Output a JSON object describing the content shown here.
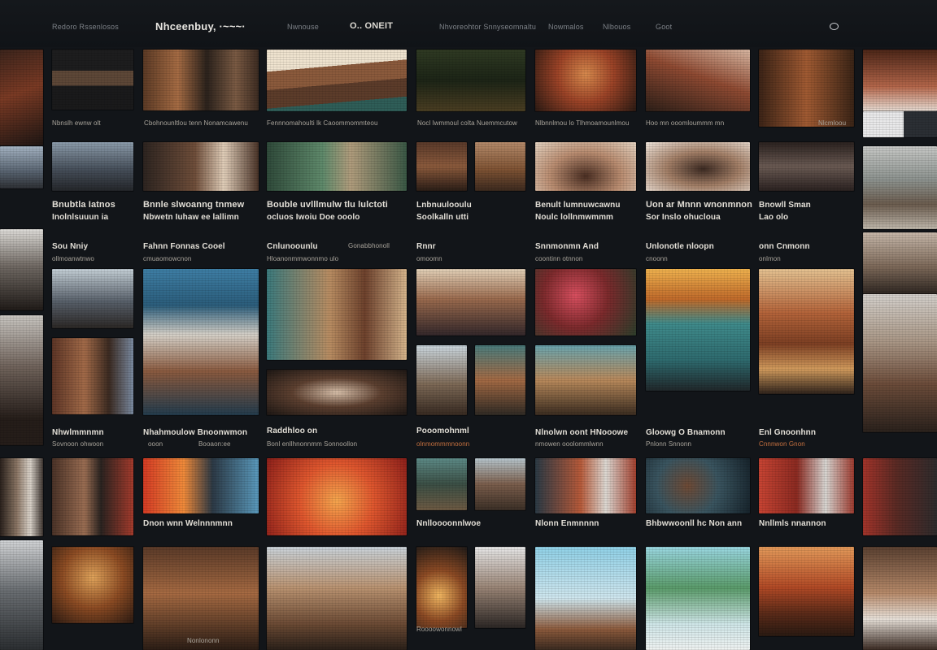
{
  "nav": {
    "items": [
      {
        "label": "Redoro Rssenlosos",
        "style": "normal"
      },
      {
        "label": "Nhceenbuy, ·~~~·",
        "style": "strong"
      },
      {
        "label": "Nwnouse",
        "style": "normal"
      },
      {
        "label": "O.. ONEIT",
        "style": "medium"
      },
      {
        "label": "Nhvoreohtor Snnyseomnaltu",
        "style": "normal"
      },
      {
        "label": "Nowmalos",
        "style": "normal"
      },
      {
        "label": "Nlbouos",
        "style": "normal"
      },
      {
        "label": "Goot",
        "style": "normal"
      }
    ],
    "icon": "search-icon"
  },
  "captions": {
    "r1c1": "Nbnslh ewnw olt",
    "r1c2": "Cbohnounltlou tenn Nonamcawenu",
    "r1c3": "Fennnomahoulti lk Caoommommteou",
    "r1c4": "Nocl lwmmoul colta Nuemmcutow",
    "r1c5": "Nlbnnlmou lo Tlhmoamounlmou",
    "r1c6": "Hoo mn ooomloummm mn",
    "r1c7": "Nlcmloou",
    "r2c1a": "Bnubtla Iatnos",
    "r2c1b": "Inolnlsuuun ia",
    "r2c2a": "Bnnle slwoanng tnmew",
    "r2c2b": "Nbwetn Iuhaw ee lallimn",
    "r2c3a": "Bouble uvlllmulw tlu lulctoti",
    "r2c3b": "ocluos Iwoiu Doe ooolo",
    "r2c4a": "Lnbnuulooulu",
    "r2c4b": "Soolkalln utti",
    "r2c5a": "Benult lumnuwcawnu",
    "r2c5b": "Noulc lollnmwmmm",
    "r2c6a": "Uon ar Mnnn wnonmnon",
    "r2c6b": "Sor Inslo ohucloua",
    "r2c7a": "Bnowll Sman",
    "r2c7b": "Lao olo",
    "r3c1a": "Sou   Nniy",
    "r3c1b": "ollmoanwtnwo",
    "r3c2a": "Fahnn Fonnas    Cooel",
    "r3c2b": "cmuaomowcnon",
    "r3c3a": "Cnlunoounlu",
    "r3c3b": "Gonabbhonoll",
    "r3c3c": "Hloanonmmwonnmo ulo",
    "r3c4a": "Rnnr",
    "r3c4b": "omoomn",
    "r3c5a": "Snnmonmn And",
    "r3c5b": "coontinn  otnnon",
    "r3c6a": "Unlonotle   nloopn",
    "r3c6b": "cnoonn",
    "r3c7a": "onn Cnmonn",
    "r3c7b": "onlmon",
    "r4c1a": "Nhwlmmnmn",
    "r4c1b": "Sovnoon ohwoon",
    "r4c2a": "Nhahmoulow Bnoonwmon",
    "r4c2b": "ooon",
    "r4c2c": "Booaon:ee",
    "r4c3a": "Raddhloo on",
    "r4c3b": "Bonl enllhnonnmm Sonnoollon",
    "r4c4a": "Pooomohnml",
    "r4c4b": "olnmommmnoonn",
    "r4c5a": "Nlnolwn oont HNooowe",
    "r4c5b": "nmowen ooolommlwnn",
    "r4c6a": "Gloowg  O Bnamonn",
    "r4c6b": "Pnlonn Snnonn",
    "r4c7a": "Enl Gnoonhnn",
    "r4c7b": "Cnnnwon Gnon",
    "r5c2": "Dnon wnn Welnnnmnn",
    "r5c4": "Nnlloooonnlwoe",
    "r5c5": "Nlonn Enmnnnn",
    "r5c6": "Bhbwwoonll hc Non ann",
    "r5c7": "Nnllmls nnannon",
    "r6c2": "Nonlononn",
    "r6c3": "Roooowonnowl"
  },
  "colors": {
    "background": "#121519",
    "accent": "#c7713f"
  }
}
